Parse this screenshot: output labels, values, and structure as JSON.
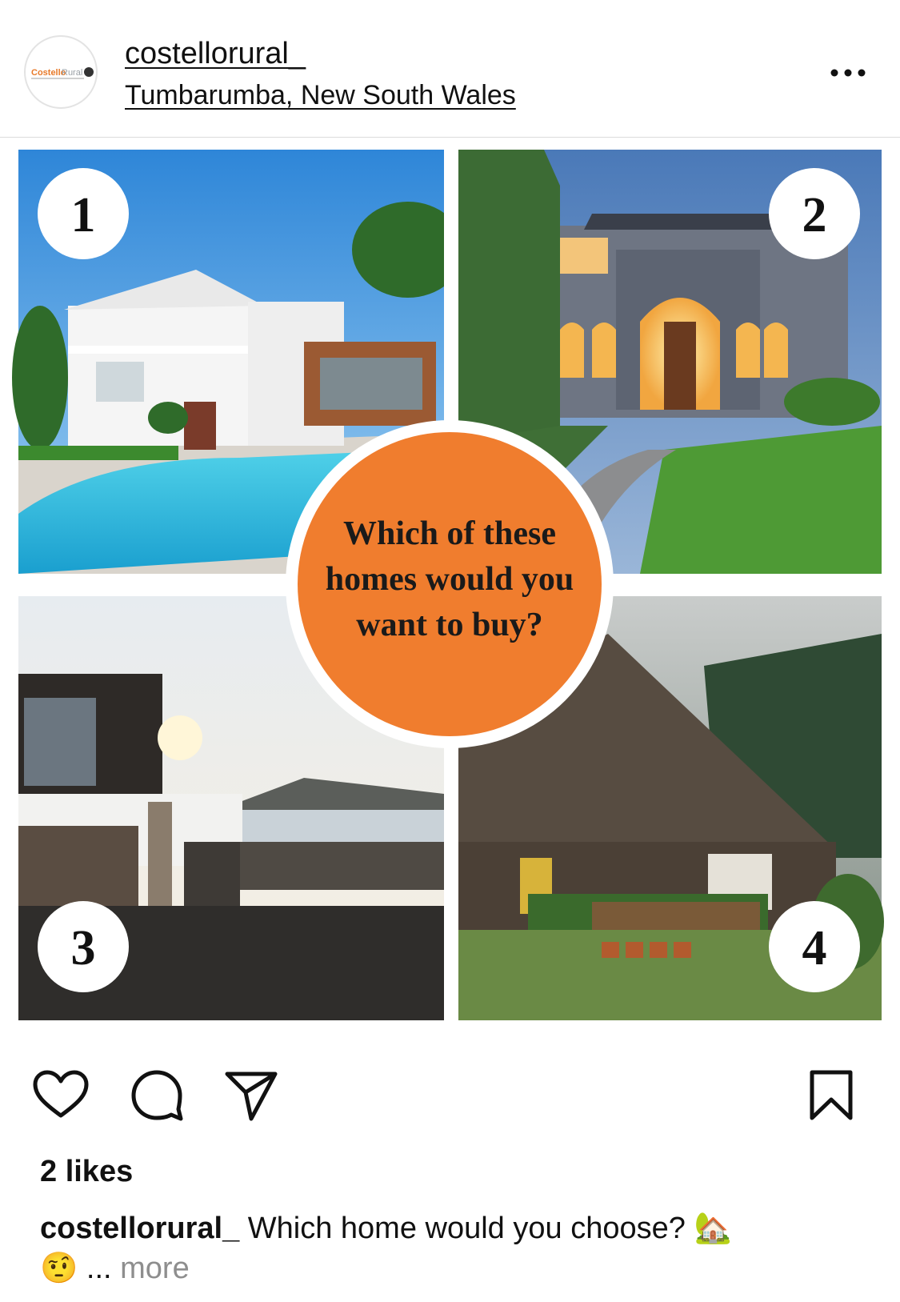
{
  "header": {
    "username": "costellorural_",
    "location": "Tumbarumba, New South Wales",
    "avatar_brand": "Costello",
    "avatar_brand_suffix": "Rural",
    "more_icon": "more-horizontal-icon"
  },
  "post": {
    "image_numbers": [
      "1",
      "2",
      "3",
      "4"
    ],
    "overlay_line1": "Which of these",
    "overlay_line2": "homes would you",
    "overlay_line3": "want to buy?",
    "overlay_color": "#f07d2e"
  },
  "actions": {
    "like_icon": "heart-icon",
    "comment_icon": "comment-icon",
    "share_icon": "paper-plane-icon",
    "save_icon": "bookmark-icon"
  },
  "likes": "2 likes",
  "caption": {
    "username": "costellorural_",
    "text": "Which home would you choose?",
    "emoji1": "🏡",
    "emoji2": "🤨",
    "ellipsis": "...",
    "more": "more"
  }
}
